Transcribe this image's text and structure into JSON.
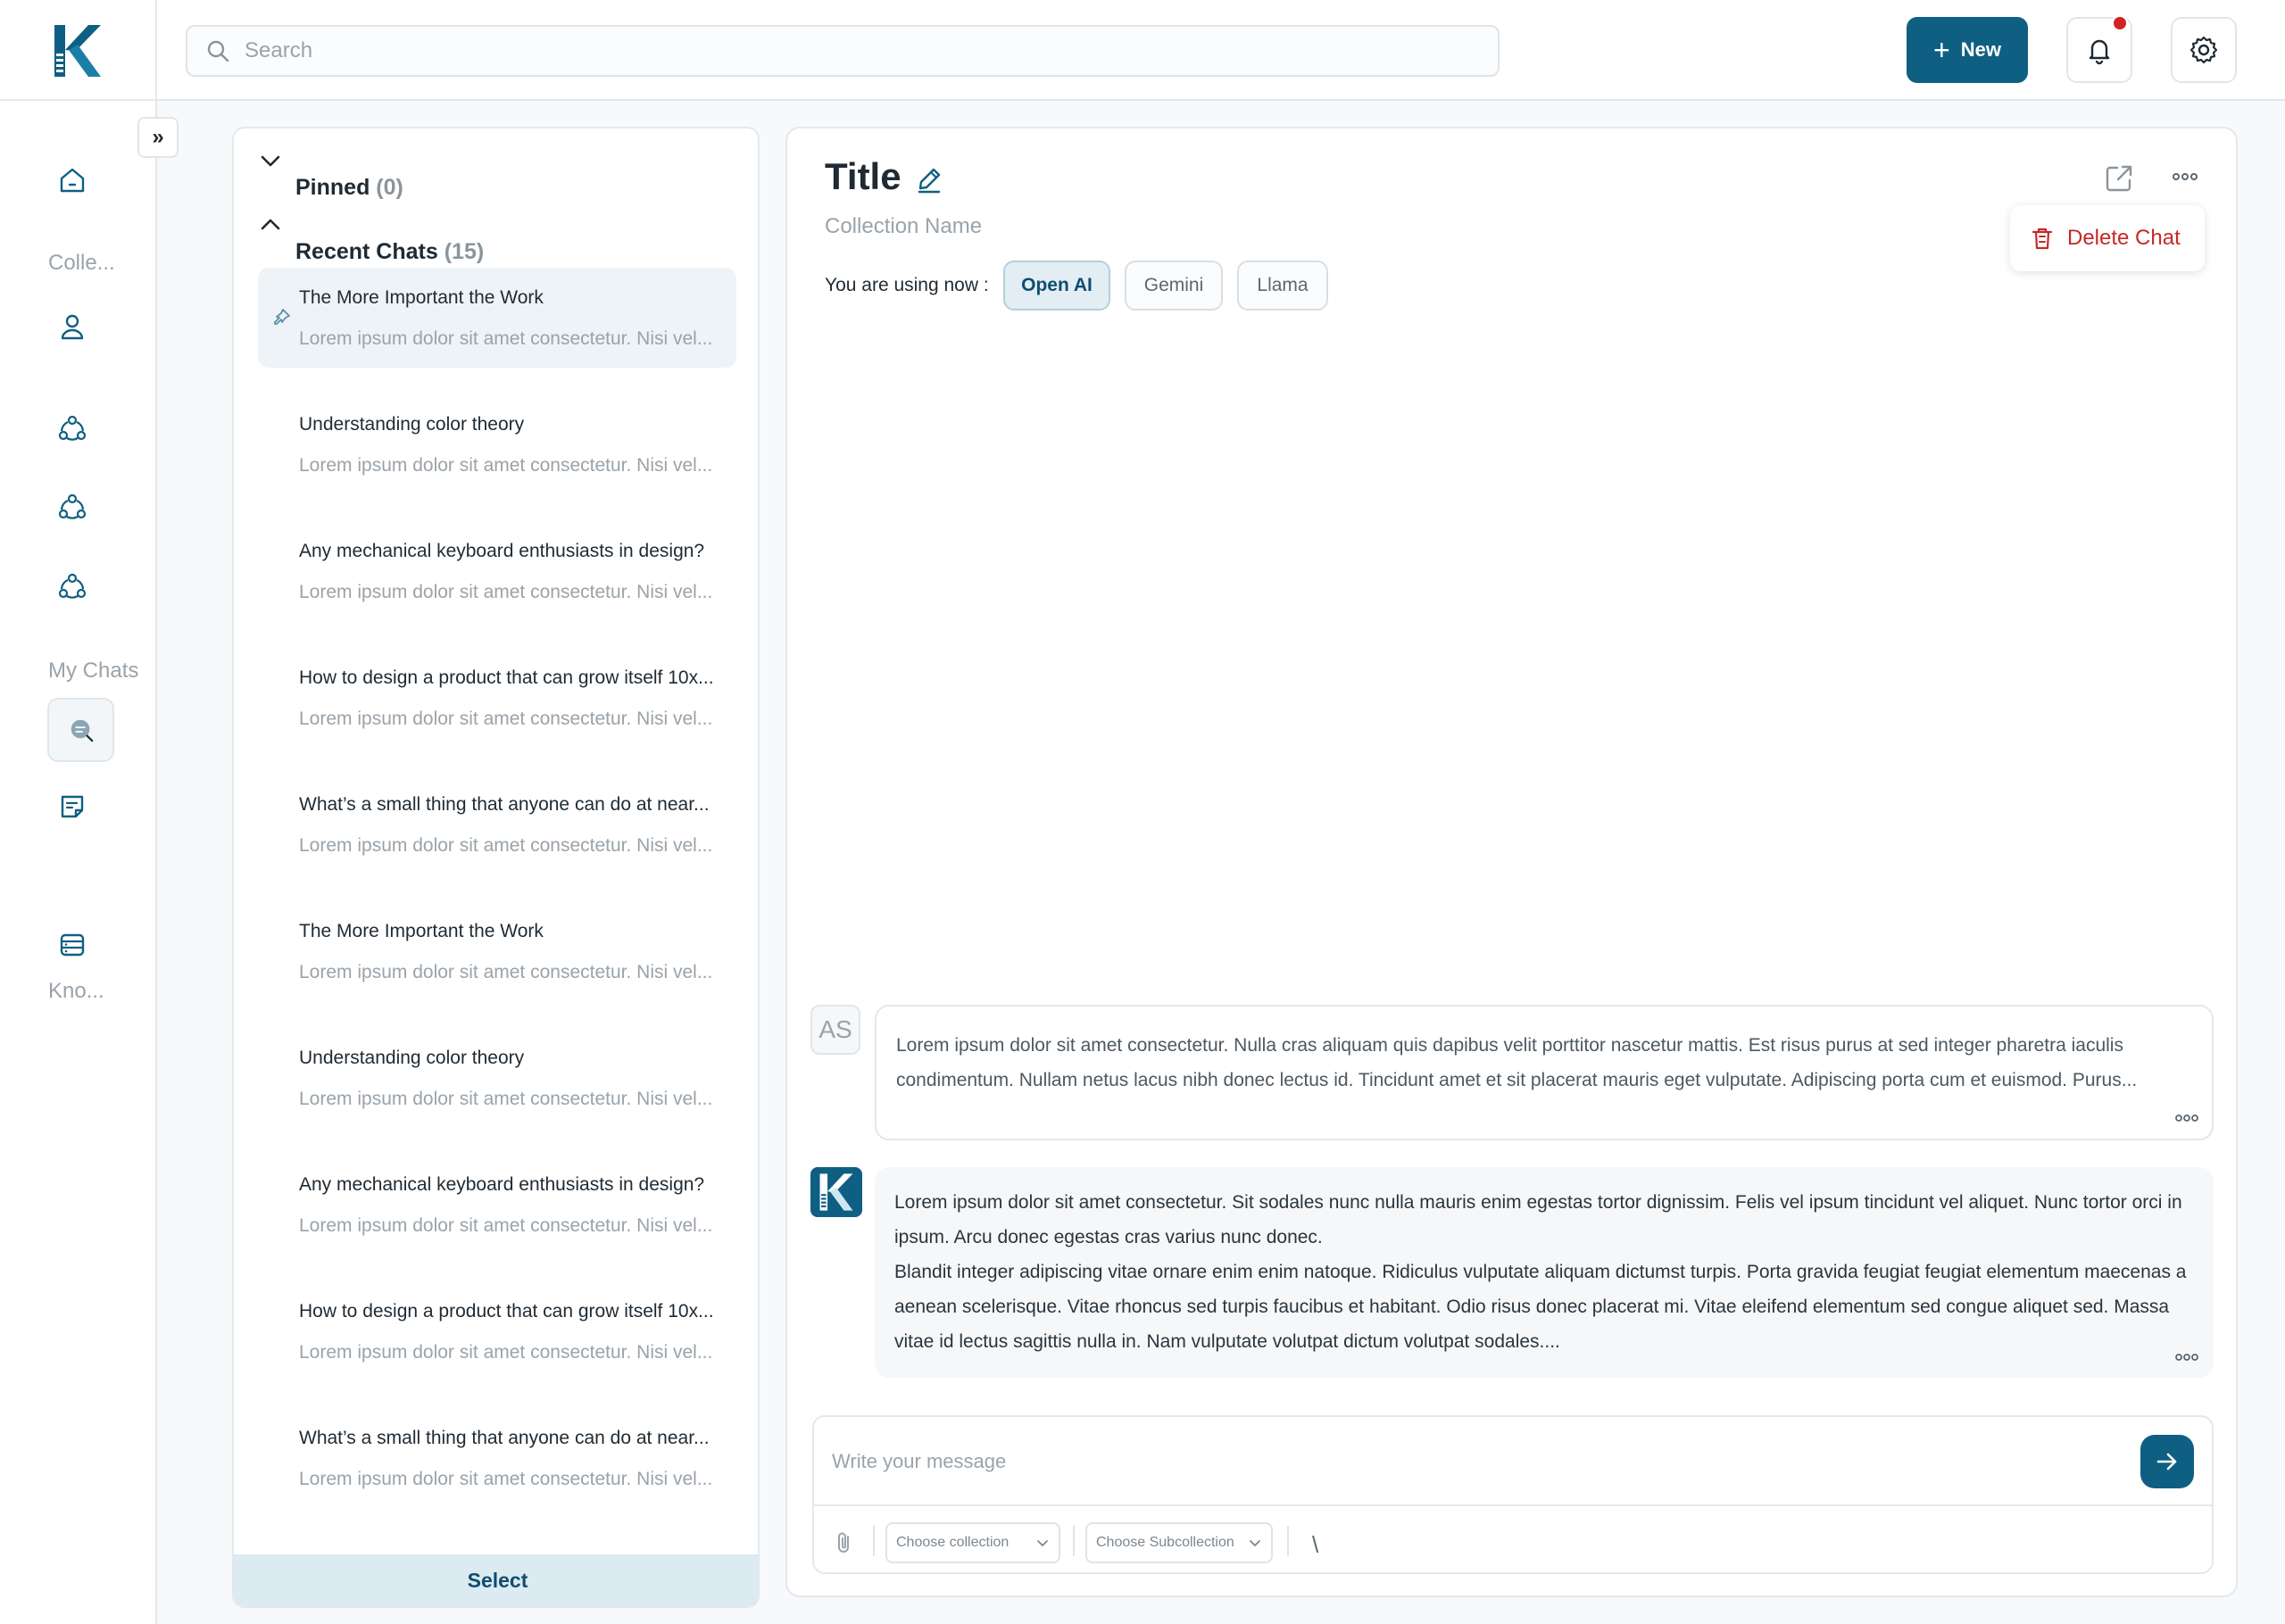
{
  "header": {
    "search_placeholder": "Search",
    "new_label": "New",
    "plus_glyph": "+",
    "has_notification": true
  },
  "rail": {
    "collapse_glyph": "»",
    "labels": {
      "collections": "Colle...",
      "my_chats": "My Chats",
      "knowledge": "Kno..."
    }
  },
  "chat_list": {
    "pinned": {
      "label": "Pinned",
      "count": "(0)"
    },
    "recent": {
      "label": "Recent Chats",
      "count": "(15)"
    },
    "items": [
      {
        "title": "The More Important the Work",
        "snippet": "Lorem ipsum dolor sit amet consectetur. Nisi vel..."
      },
      {
        "title": "Understanding color theory",
        "snippet": "Lorem ipsum dolor sit amet consectetur. Nisi vel..."
      },
      {
        "title": "Any mechanical keyboard enthusiasts in design?",
        "snippet": "Lorem ipsum dolor sit amet consectetur. Nisi vel..."
      },
      {
        "title": "How to design a product that can grow itself 10x...",
        "snippet": "Lorem ipsum dolor sit amet consectetur. Nisi vel..."
      },
      {
        "title": "What’s a small thing that anyone can do at near...",
        "snippet": "Lorem ipsum dolor sit amet consectetur. Nisi vel..."
      },
      {
        "title": "The More Important the Work",
        "snippet": "Lorem ipsum dolor sit amet consectetur. Nisi vel..."
      },
      {
        "title": "Understanding color theory",
        "snippet": "Lorem ipsum dolor sit amet consectetur. Nisi vel..."
      },
      {
        "title": "Any mechanical keyboard enthusiasts in design?",
        "snippet": "Lorem ipsum dolor sit amet consectetur. Nisi vel..."
      },
      {
        "title": "How to design a product that can grow itself 10x...",
        "snippet": "Lorem ipsum dolor sit amet consectetur. Nisi vel..."
      },
      {
        "title": "What’s a small thing that anyone can do at near...",
        "snippet": "Lorem ipsum dolor sit amet consectetur. Nisi vel..."
      }
    ],
    "select_label": "Select"
  },
  "chat": {
    "title": "Title",
    "collection_name": "Collection Name",
    "using_label": "You are using now :",
    "models": [
      "Open AI",
      "Gemini",
      "Llama"
    ],
    "active_model": "Open AI",
    "delete_label": "Delete Chat",
    "user_initials": "AS",
    "user_message": "Lorem ipsum dolor sit amet consectetur. Nulla cras aliquam quis dapibus velit porttitor nascetur mattis. Est risus purus at sed integer pharetra iaculis condimentum. Nullam netus lacus nibh donec lectus id. Tincidunt amet et sit placerat mauris eget vulputate. Adipiscing porta cum et euismod. Purus...",
    "ai_message_1": "Lorem ipsum dolor sit amet consectetur. Sit sodales nunc nulla mauris enim egestas tortor dignissim. Felis vel ipsum tincidunt vel aliquet. Nunc tortor orci in ipsum. Arcu donec egestas cras varius nunc donec.",
    "ai_message_2": "Blandit integer adipiscing vitae ornare enim enim natoque. Ridiculus vulputate aliquam dictumst turpis. Porta gravida feugiat feugiat elementum maecenas a aenean scelerisque. Vitae rhoncus sed turpis faucibus et habitant. Odio risus donec placerat mi. Vitae eleifend elementum sed congue aliquet sed. Massa vitae id lectus sagittis nulla in. Nam vulputate volutpat dictum volutpat sodales....",
    "composer_placeholder": "Write your message",
    "collection_dropdown": "Choose collection",
    "subcollection_dropdown": "Choose Subcollection",
    "slash_glyph": "\\"
  },
  "colors": {
    "brand": "#0f5f82",
    "danger": "#c62828",
    "notification": "#d22222"
  }
}
